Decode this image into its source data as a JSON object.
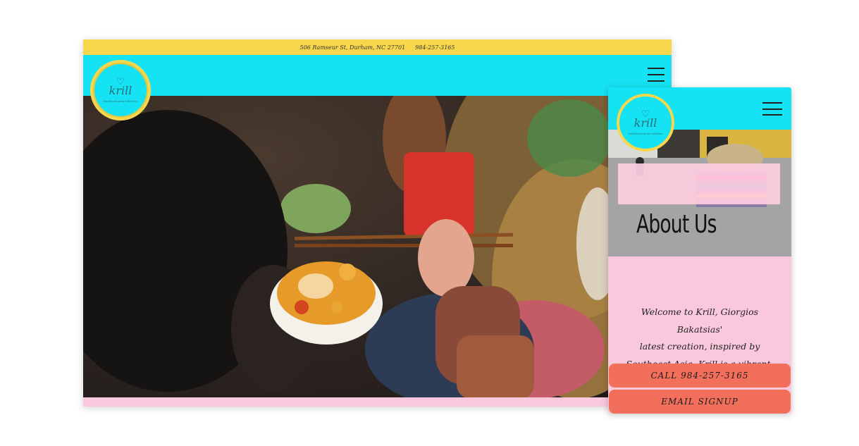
{
  "desktop": {
    "topbar": {
      "address": "506 Ramseur St, Durham, NC 27701",
      "phone": "984-257-3165"
    },
    "logo": {
      "name": "krill",
      "tagline": "Southeast Asian Kitchen"
    },
    "menu_icon": "hamburger-menu-icon",
    "hero_image": "street-food-noodle-soup-photo"
  },
  "mobile": {
    "logo": {
      "name": "krill",
      "tagline": "Southeast Asian Kitchen"
    },
    "menu_icon": "hamburger-menu-icon",
    "about_title": "About Us",
    "body_lines": [
      "Welcome to Krill, Giorgios Bakatsias'",
      "latest creation, inspired by",
      "Southeast Asia. Krill is a vibrant,"
    ],
    "call_button": "CALL 984-257-3165",
    "email_button": "EMAIL SIGNUP"
  },
  "colors": {
    "cyan": "#15e2f2",
    "yellow": "#f9d74d",
    "pink": "#f9c8dc",
    "coral": "#f26f5b"
  }
}
